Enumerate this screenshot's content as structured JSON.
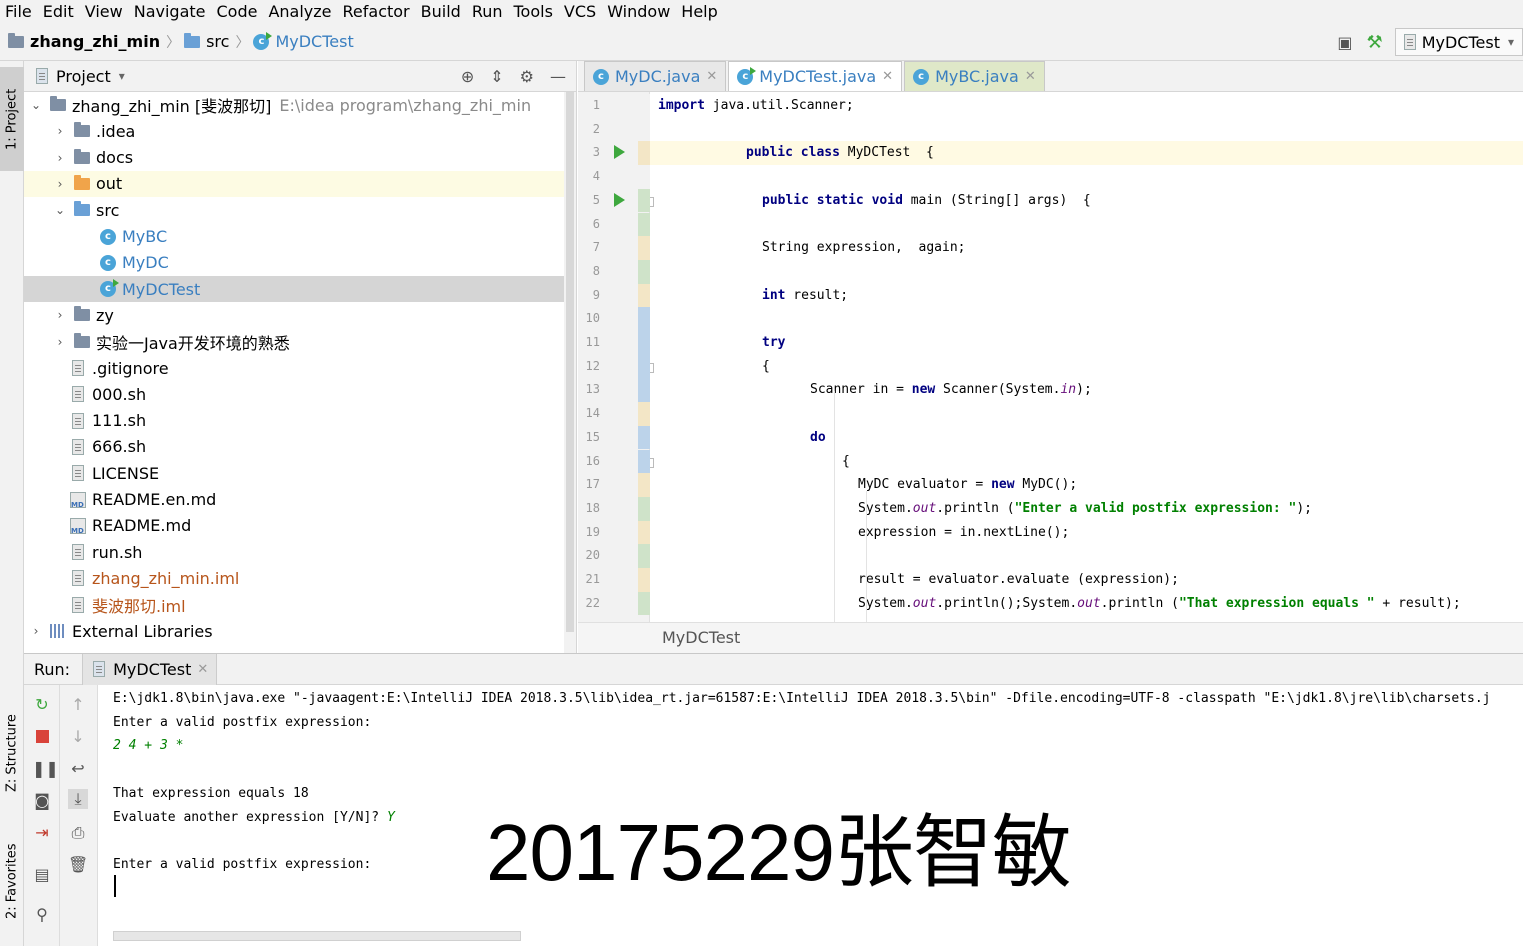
{
  "menu": [
    "File",
    "Edit",
    "View",
    "Navigate",
    "Code",
    "Analyze",
    "Refactor",
    "Build",
    "Run",
    "Tools",
    "VCS",
    "Window",
    "Help"
  ],
  "breadcrumb": {
    "project": "zhang_zhi_min",
    "folder": "src",
    "file": "MyDCTest"
  },
  "run_config": "MyDCTest",
  "side_tabs": {
    "project": "1: Project",
    "structure": "Z: Structure",
    "favorites": "2: Favorites"
  },
  "project_panel": {
    "title": "Project",
    "root": {
      "name": "zhang_zhi_min [斐波那切]",
      "path": "E:\\idea program\\zhang_zhi_min"
    },
    "items": [
      {
        "label": ".idea",
        "kind": "folder"
      },
      {
        "label": "docs",
        "kind": "folder"
      },
      {
        "label": "out",
        "kind": "folder-orange"
      },
      {
        "label": "src",
        "kind": "folder-blue"
      },
      {
        "label": "MyBC",
        "kind": "class"
      },
      {
        "label": "MyDC",
        "kind": "class"
      },
      {
        "label": "MyDCTest",
        "kind": "class-run"
      },
      {
        "label": "zy",
        "kind": "folder"
      },
      {
        "label": "实验一Java开发环境的熟悉",
        "kind": "folder"
      },
      {
        "label": ".gitignore",
        "kind": "file"
      },
      {
        "label": "000.sh",
        "kind": "file"
      },
      {
        "label": "111.sh",
        "kind": "file"
      },
      {
        "label": "666.sh",
        "kind": "file"
      },
      {
        "label": "LICENSE",
        "kind": "file"
      },
      {
        "label": "README.en.md",
        "kind": "md"
      },
      {
        "label": "README.md",
        "kind": "md"
      },
      {
        "label": "run.sh",
        "kind": "file"
      },
      {
        "label": "zhang_zhi_min.iml",
        "kind": "iml"
      },
      {
        "label": "斐波那切.iml",
        "kind": "iml"
      },
      {
        "label": "External Libraries",
        "kind": "lib"
      }
    ]
  },
  "editor": {
    "tabs": [
      {
        "label": "MyDC.java"
      },
      {
        "label": "MyDCTest.java"
      },
      {
        "label": "MyBC.java"
      }
    ],
    "footer": "MyDCTest",
    "lines": [
      "import java.util.Scanner;",
      "",
      "public class MyDCTest  {",
      "",
      "public static void main (String[] args)  {",
      "",
      "String expression,  again;",
      "",
      "int result;",
      "",
      "try",
      "{",
      "Scanner in = new Scanner(System.in);",
      "",
      "do",
      "{",
      "MyDC evaluator = new MyDC();",
      "System.out.println (\"Enter a valid postfix expression: \");",
      "expression = in.nextLine();",
      "",
      "result = evaluator.evaluate (expression);",
      "System.out.println();System.out.println (\"That expression equals \" + result);"
    ]
  },
  "run_panel": {
    "label": "Run:",
    "tab": "MyDCTest",
    "output": [
      {
        "text": "E:\\jdk1.8\\bin\\java.exe \"-javaagent:E:\\IntelliJ IDEA 2018.3.5\\lib\\idea_rt.jar=61587:E:\\IntelliJ IDEA 2018.3.5\\bin\" -Dfile.encoding=UTF-8 -classpath \"E:\\jdk1.8\\jre\\lib\\charsets.j",
        "type": "out"
      },
      {
        "text": "Enter a valid postfix expression:",
        "type": "out"
      },
      {
        "text": "2 4 + 3 *",
        "type": "in"
      },
      {
        "text": "",
        "type": "out"
      },
      {
        "text": "That expression equals 18",
        "type": "out"
      },
      {
        "text": "Evaluate another expression [Y/N]? ",
        "type": "out",
        "input": "Y"
      },
      {
        "text": "",
        "type": "out"
      },
      {
        "text": "Enter a valid postfix expression:",
        "type": "out"
      }
    ]
  },
  "watermark": "20175229张智敏"
}
